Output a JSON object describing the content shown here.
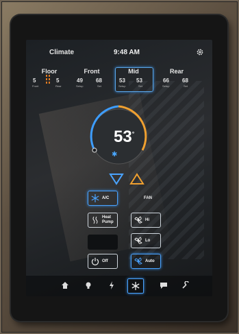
{
  "header": {
    "title": "Climate",
    "time": "9:48 AM",
    "settings_icon": "gear-icon"
  },
  "zones": [
    {
      "name": "Floor",
      "left_value": "5",
      "left_label": "Front",
      "right_value": "5",
      "right_label": "Rear",
      "selected": false
    },
    {
      "name": "Front",
      "left_value": "49",
      "left_label": "Setup",
      "right_value": "68",
      "right_label": "Set",
      "selected": false
    },
    {
      "name": "Mid",
      "left_value": "53",
      "left_label": "Setup",
      "right_value": "53",
      "right_label": "Set",
      "selected": true
    },
    {
      "name": "Rear",
      "left_value": "66",
      "left_label": "Setup",
      "right_value": "68",
      "right_label": "Set",
      "selected": false
    }
  ],
  "dial": {
    "temperature": "53",
    "unit_mark": "°",
    "mode_icon": "snowflake-icon"
  },
  "controls": {
    "ac_label": "A/C",
    "heat_pump_label_line1": "Heat",
    "heat_pump_label_line2": "Pump",
    "off_label": "Off",
    "fan_label": "FAN",
    "fan_hi_label": "Hi",
    "fan_lo_label": "Lo",
    "fan_auto_label": "Auto"
  },
  "navbar": {
    "items": [
      "home-icon",
      "lightbulb-icon",
      "power-icon",
      "snowflake-icon",
      "chat-icon",
      "tools-icon"
    ],
    "active_index": 3
  },
  "colors": {
    "accent_blue": "#4aa3ff",
    "accent_orange": "#f0a030",
    "screen_bg": "#1f2226"
  }
}
